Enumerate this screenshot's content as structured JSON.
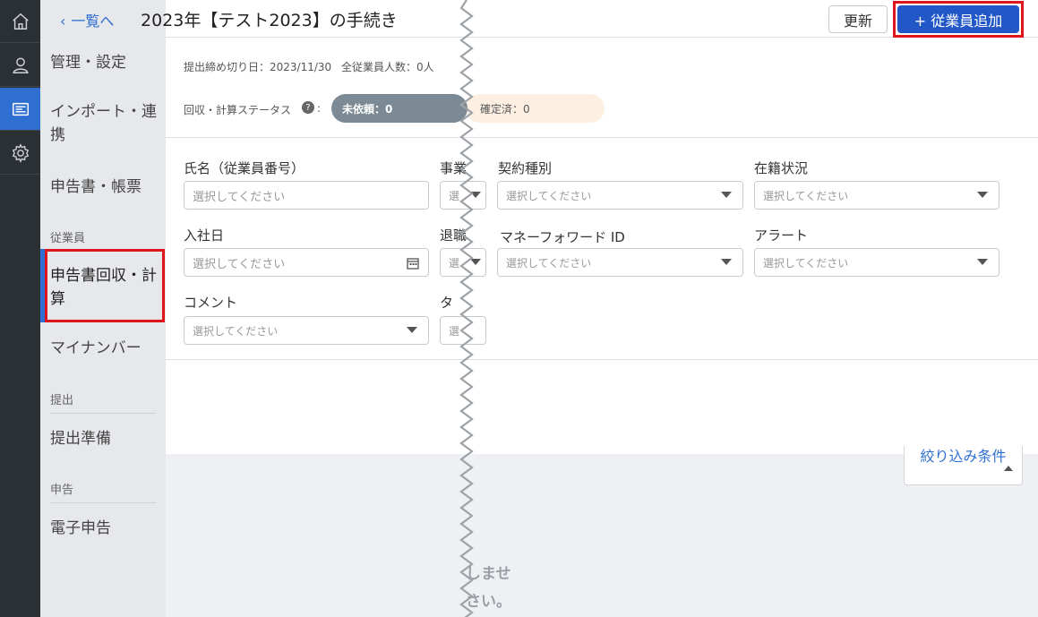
{
  "rail": {
    "icons": [
      "home-icon",
      "user-icon",
      "document-list-icon",
      "gear-icon"
    ]
  },
  "sidebar": {
    "items": [
      {
        "label": "管理・設定"
      },
      {
        "label": "インポート・連携"
      },
      {
        "label": "申告書・帳票"
      },
      {
        "label": "申告書回収・計算"
      },
      {
        "label": "マイナンバー"
      },
      {
        "label": "提出準備"
      },
      {
        "label": "電子申告"
      }
    ],
    "headers": {
      "employee": "従業員",
      "submit": "提出",
      "report": "申告"
    }
  },
  "header": {
    "back_label": "一覧へ",
    "title": "2023年【テスト2023】の手続き",
    "refresh_label": "更新",
    "add_label": "+ 従業員追加"
  },
  "info": {
    "deadline": "提出締め切り日：2023/11/30",
    "employee_count": "全従業員人数：0人",
    "status_label": "回収・計算ステータス",
    "status_not_requested": "未依頼：0",
    "status_confirmed": "確定済：0"
  },
  "filters": {
    "placeholder": "選択してください",
    "name_label": "氏名（従業員番号）",
    "office_label": "事業",
    "contract_label": "契約種別",
    "enrollment_label": "在籍状況",
    "join_date_label": "入社日",
    "leave_label": "退職",
    "mfid_label": "マネーフォワード ID",
    "alert_label": "アラート",
    "comment_label": "コメント",
    "tag_label": "タ",
    "trunc_placeholder": "選"
  },
  "lower": {
    "filter_toggle": "絞り込み条件",
    "empty_line1": "しませ",
    "empty_line2": "さい。"
  },
  "colors": {
    "primary": "#2257c8",
    "highlight": "#e0141b",
    "rail": "#2b3035",
    "status_gray": "#7b8a95",
    "status_peach": "#fdf0e2"
  }
}
